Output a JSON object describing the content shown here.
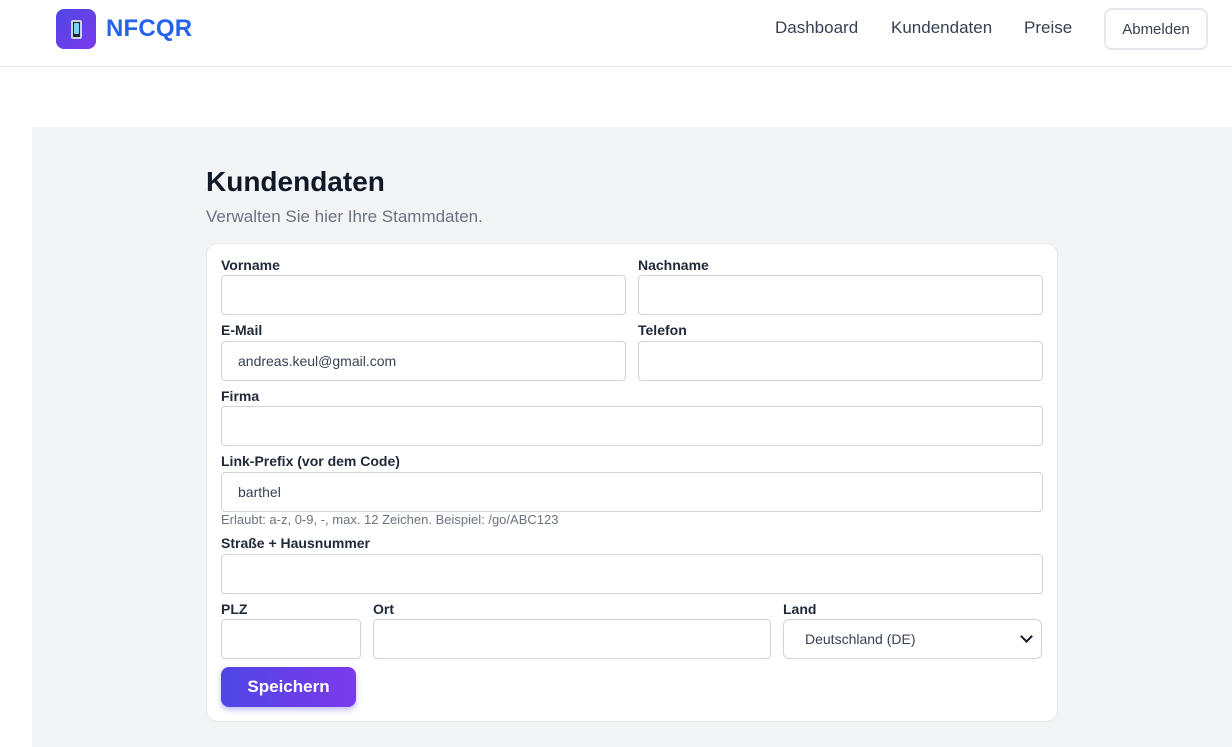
{
  "header": {
    "brand": "NFCQR",
    "logo_icon": "phone-icon",
    "nav": {
      "dashboard": "Dashboard",
      "kundendaten": "Kundendaten",
      "preise": "Preise"
    },
    "logout_label": "Abmelden"
  },
  "page": {
    "title": "Kundendaten",
    "subtitle": "Verwalten Sie hier Ihre Stammdaten."
  },
  "form": {
    "vorname": {
      "label": "Vorname",
      "value": ""
    },
    "nachname": {
      "label": "Nachname",
      "value": ""
    },
    "email": {
      "label": "E-Mail",
      "value": "andreas.keul@gmail.com"
    },
    "telefon": {
      "label": "Telefon",
      "value": ""
    },
    "firma": {
      "label": "Firma",
      "value": ""
    },
    "link_prefix": {
      "label": "Link-Prefix (vor dem Code)",
      "value": "barthel",
      "hint": "Erlaubt: a-z, 0-9, -, max. 12 Zeichen. Beispiel: /go/ABC123"
    },
    "strasse": {
      "label": "Straße + Hausnummer",
      "value": ""
    },
    "plz": {
      "label": "PLZ",
      "value": ""
    },
    "ort": {
      "label": "Ort",
      "value": ""
    },
    "land": {
      "label": "Land",
      "selected": "Deutschland (DE)"
    },
    "save_label": "Speichern"
  },
  "colors": {
    "brand": "#2563eb",
    "accent_start": "#4f46e5",
    "accent_end": "#7c3aed",
    "page_bg": "#f3f4f6"
  }
}
